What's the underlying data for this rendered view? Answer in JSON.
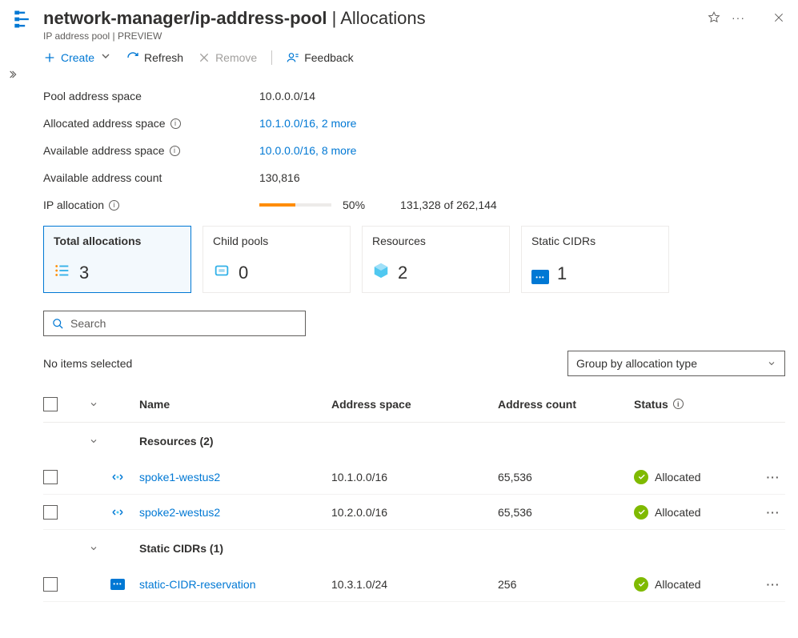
{
  "header": {
    "resource_path": "network-manager/ip-address-pool",
    "section": "Allocations",
    "subtitle": "IP address pool | PREVIEW"
  },
  "toolbar": {
    "create": "Create",
    "refresh": "Refresh",
    "remove": "Remove",
    "feedback": "Feedback"
  },
  "summary": {
    "pool_label": "Pool address space",
    "pool_value": "10.0.0.0/14",
    "allocated_label": "Allocated address space",
    "allocated_value": "10.1.0.0/16, 2 more",
    "available_label": "Available address space",
    "available_value": "10.0.0.0/16, 8 more",
    "count_label": "Available address count",
    "count_value": "130,816",
    "alloc_label": "IP allocation",
    "alloc_percent": "50%",
    "alloc_detail": "131,328 of 262,144",
    "alloc_width": 50
  },
  "cards": [
    {
      "title": "Total allocations",
      "value": "3"
    },
    {
      "title": "Child pools",
      "value": "0"
    },
    {
      "title": "Resources",
      "value": "2"
    },
    {
      "title": "Static CIDRs",
      "value": "1"
    }
  ],
  "search": {
    "placeholder": "Search"
  },
  "selection_text": "No items selected",
  "group_by_label": "Group by allocation type",
  "columns": {
    "name": "Name",
    "address_space": "Address space",
    "address_count": "Address count",
    "status": "Status"
  },
  "groups": [
    {
      "label": "Resources (2)",
      "type": "resource",
      "rows": [
        {
          "name": "spoke1-westus2",
          "address_space": "10.1.0.0/16",
          "address_count": "65,536",
          "status": "Allocated"
        },
        {
          "name": "spoke2-westus2",
          "address_space": "10.2.0.0/16",
          "address_count": "65,536",
          "status": "Allocated"
        }
      ]
    },
    {
      "label": "Static CIDRs (1)",
      "type": "cidr",
      "rows": [
        {
          "name": "static-CIDR-reservation",
          "address_space": "10.3.1.0/24",
          "address_count": "256",
          "status": "Allocated"
        }
      ]
    }
  ]
}
